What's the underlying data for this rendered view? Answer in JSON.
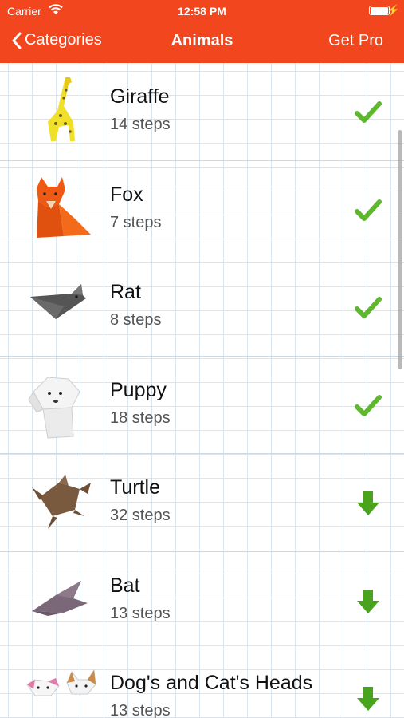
{
  "status_bar": {
    "carrier": "Carrier",
    "time": "12:58 PM",
    "battery_level": 1.0
  },
  "nav": {
    "back_label": "Categories",
    "title": "Animals",
    "action_label": "Get Pro"
  },
  "items": [
    {
      "name": "Giraffe",
      "steps": "14 steps",
      "status": "downloaded",
      "icon": "giraffe-origami-icon"
    },
    {
      "name": "Fox",
      "steps": "7 steps",
      "status": "downloaded",
      "icon": "fox-origami-icon"
    },
    {
      "name": "Rat",
      "steps": "8 steps",
      "status": "downloaded",
      "icon": "rat-origami-icon"
    },
    {
      "name": "Puppy",
      "steps": "18 steps",
      "status": "downloaded",
      "icon": "puppy-origami-icon"
    },
    {
      "name": "Turtle",
      "steps": "32 steps",
      "status": "download",
      "icon": "turtle-origami-icon"
    },
    {
      "name": "Bat",
      "steps": "13 steps",
      "status": "download",
      "icon": "bat-origami-icon"
    },
    {
      "name": "Dog's and Cat's Heads",
      "steps": "13 steps",
      "status": "download",
      "icon": "dog-cat-heads-origami-icon"
    }
  ],
  "colors": {
    "header": "#f2461f",
    "check": "#5fb72e",
    "download_arrow": "#4aa31f"
  }
}
